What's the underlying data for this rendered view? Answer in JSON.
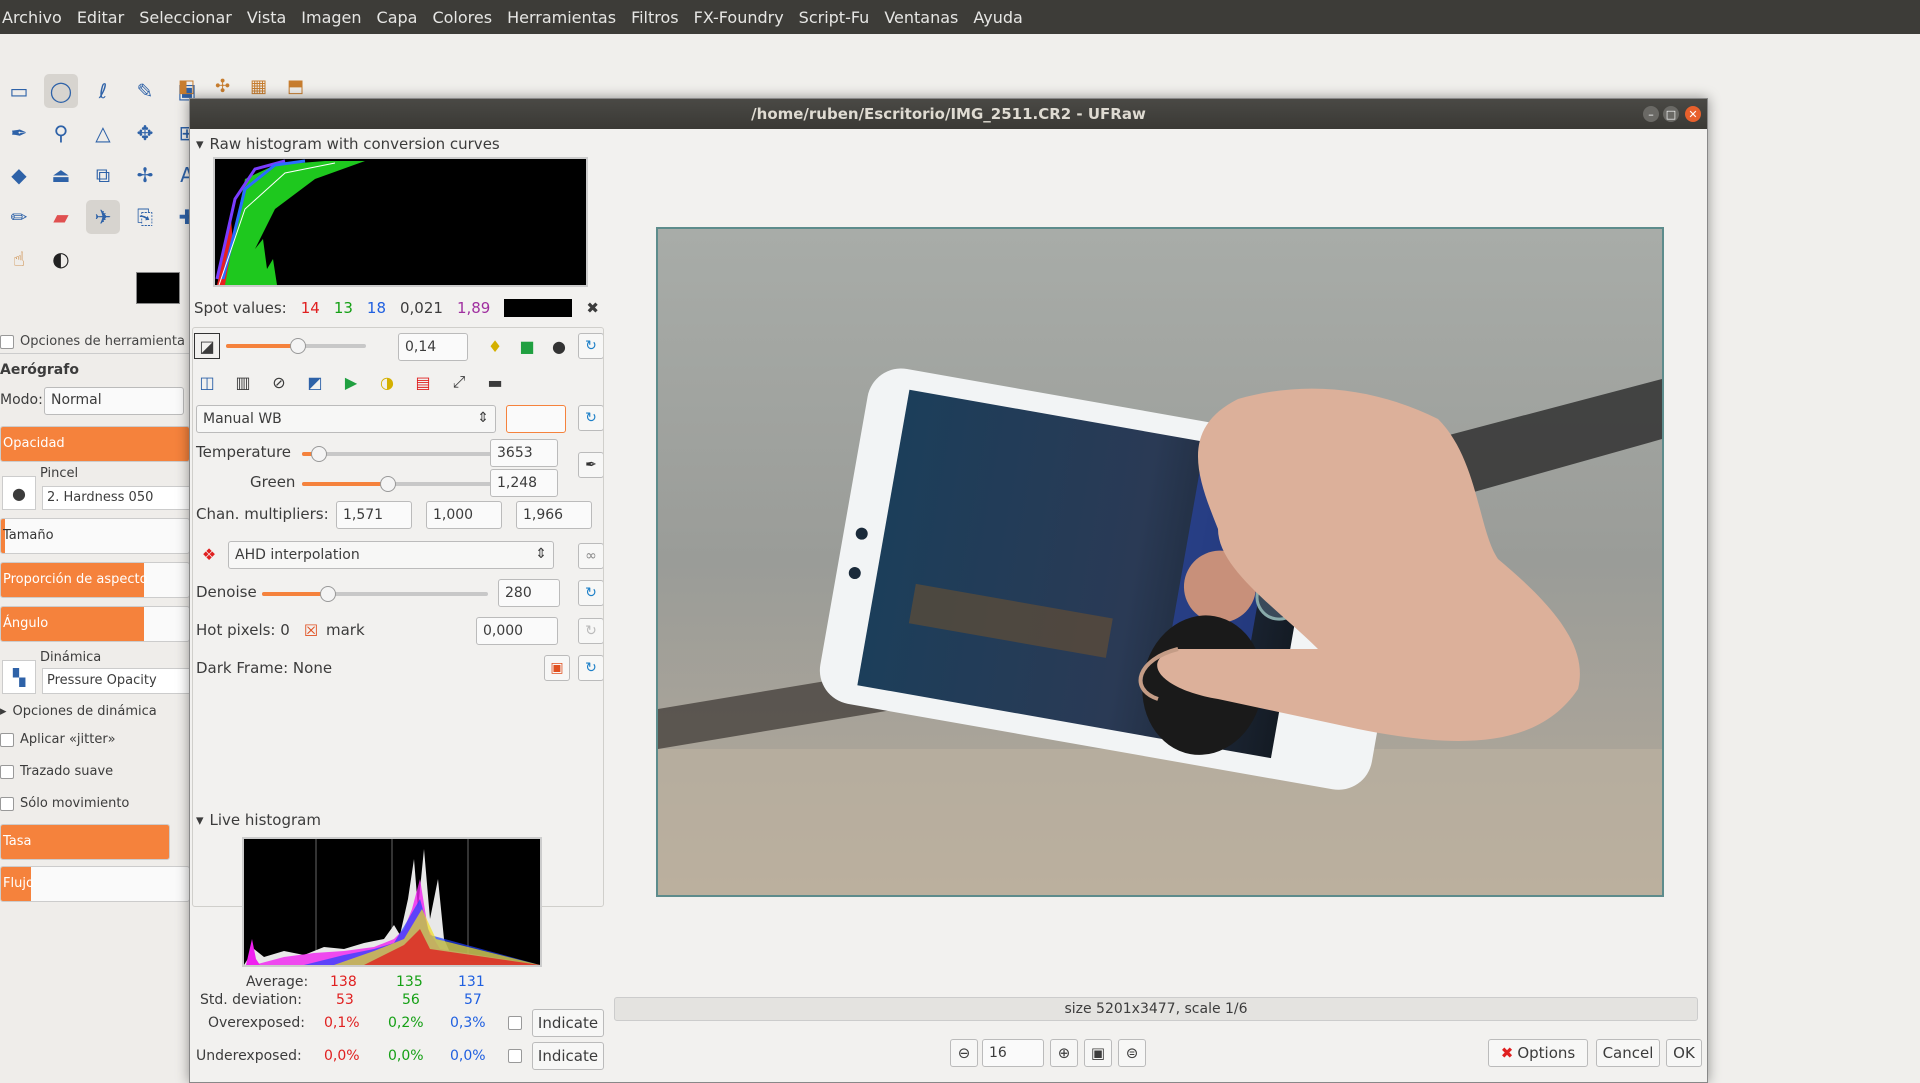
{
  "menubar": {
    "items": [
      "Archivo",
      "Editar",
      "Seleccionar",
      "Vista",
      "Imagen",
      "Capa",
      "Colores",
      "Herramientas",
      "Filtros",
      "FX-Foundry",
      "Script-Fu",
      "Ventanas",
      "Ayuda"
    ]
  },
  "tool_options": {
    "header": "Opciones de herramienta",
    "title": "Aerógrafo",
    "mode_label": "Modo:",
    "mode_value": "Normal",
    "opacity_label": "Opacidad",
    "brush_label": "Pincel",
    "brush_value": "2. Hardness 050",
    "size_label": "Tamaño",
    "aspect_label": "Proporción de aspecto",
    "angle_label": "Ángulo",
    "dynamics_label": "Dinámica",
    "dynamics_value": "Pressure Opacity",
    "dynamics_options": "Opciones de dinámica",
    "jitter": "Aplicar «jitter»",
    "smooth": "Trazado suave",
    "motion_only": "Sólo movimiento",
    "rate_label": "Tasa",
    "flow_label": "Flujo"
  },
  "dialog": {
    "title": "/home/ruben/Escritorio/IMG_2511.CR2 - UFRaw",
    "raw_histogram_label": "Raw histogram with conversion curves",
    "spot": {
      "label": "Spot values:",
      "r": "14",
      "g": "13",
      "b": "18",
      "v1": "0,021",
      "v2": "1,89"
    },
    "exposure": {
      "value": "0,14",
      "fraction": 0.55
    },
    "wb_preset": "Manual WB",
    "wb_spin": "",
    "temperature": {
      "label": "Temperature",
      "value": "3653",
      "fraction": 0.07
    },
    "green": {
      "label": "Green",
      "value": "1,248",
      "fraction": 0.45
    },
    "chan_multipliers": {
      "label": "Chan. multipliers:",
      "values": [
        "1,571",
        "1,000",
        "1,966"
      ]
    },
    "interpolation": "AHD interpolation",
    "denoise": {
      "label": "Denoise",
      "value": "280",
      "fraction": 0.28
    },
    "hot_pixels": {
      "label": "Hot pixels: 0",
      "mark": "mark",
      "value": "0,000"
    },
    "dark_frame": "Dark Frame:  None",
    "live_histogram_label": "Live histogram",
    "stats": {
      "average_label": "Average:",
      "average": [
        "138",
        "135",
        "131"
      ],
      "std_label": "Std. deviation:",
      "std": [
        "53",
        "56",
        "57"
      ],
      "over_label": "Overexposed:",
      "over": [
        "0,1%",
        "0,2%",
        "0,3%"
      ],
      "under_label": "Underexposed:",
      "under": [
        "0,0%",
        "0,0%",
        "0,0%"
      ],
      "indicate": "Indicate"
    },
    "size_info": "size 5201x3477, scale 1/6",
    "zoom": "16",
    "buttons": {
      "options": "Options",
      "cancel": "Cancel",
      "ok": "OK"
    }
  },
  "colors": {
    "accent": "#f5823c",
    "titlebar": "#3d3c38"
  }
}
